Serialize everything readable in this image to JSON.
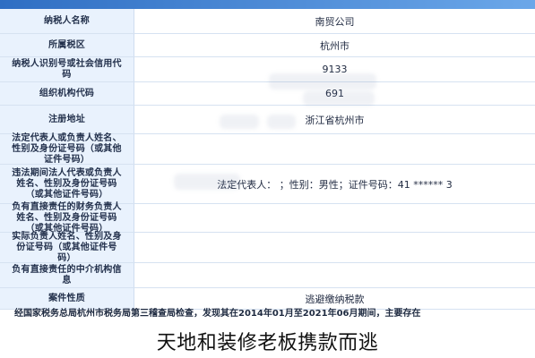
{
  "document": {
    "rows": [
      {
        "label": "纳税人名称",
        "value": "南贸公司"
      },
      {
        "label": "所属税区",
        "value": "杭州市"
      },
      {
        "label": "纳税人识别号或社会信用代码",
        "value": "9133"
      },
      {
        "label": "组织机构代码",
        "value": "691"
      },
      {
        "label": "注册地址",
        "value": "浙江省杭州市"
      },
      {
        "label": "法定代表人或负责人姓名、性别及身份证号码（或其他证件号码）",
        "value": ""
      },
      {
        "label": "违法期间法人代表或负责人姓名、性别及身份证号码（或其他证件号码）",
        "value": "法定代表人：    ；性别：男性；证件号码：41 ****** 3"
      },
      {
        "label": "负有直接责任的财务负责人姓名、性别及身份证号码（或其他证件号码）",
        "value": ""
      },
      {
        "label": "实际负责人姓名、性别及身份证号码（或其他证件号码）",
        "value": ""
      },
      {
        "label": "负有直接责任的中介机构信息",
        "value": ""
      },
      {
        "label": "案件性质",
        "value": "逃避缴纳税款"
      }
    ],
    "fact": "经国家税务总局杭州市税务局第三稽查局检查，发现其在2014年01月至2021年06月期间，主要存在"
  },
  "caption": "天地和装修老板携款而逃"
}
